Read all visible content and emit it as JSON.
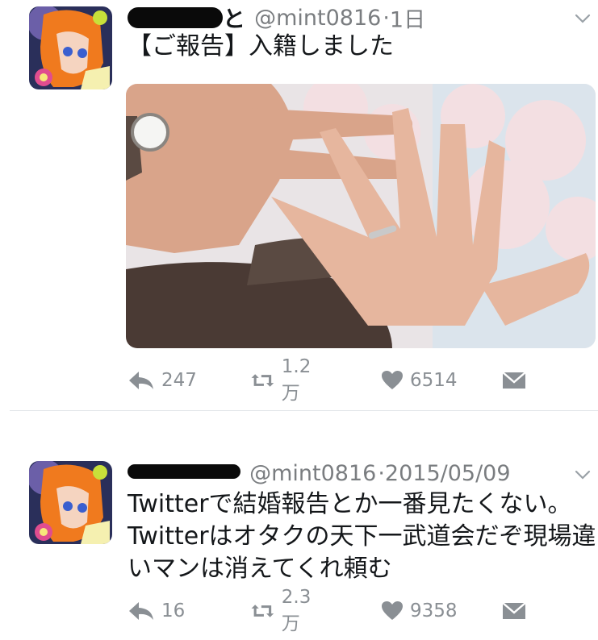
{
  "tweets": [
    {
      "name_visible_fragment": "と",
      "handle": "@mint0816",
      "sep": "·",
      "time": "1日",
      "text_lines": [
        "【ご報告】入籍しました"
      ],
      "actions": {
        "reply_count": "247",
        "retweet_count": "1.2万",
        "like_count": "6514"
      },
      "has_media": true
    },
    {
      "name_visible_fragment": "",
      "handle": "@mint0816",
      "sep": "·",
      "time": "2015/05/09",
      "text_lines": [
        "Twitterで結婚報告とか一番見たくない。",
        "Twitterはオタクの天下一武道会だぞ現場違",
        "いマンは消えてくれ頼む"
      ],
      "actions": {
        "reply_count": "16",
        "retweet_count": "2.3万",
        "like_count": "9358"
      },
      "has_media": false
    }
  ],
  "icons": {
    "reply": "reply-arrow-icon",
    "retweet": "retweet-icon",
    "like": "heart-icon",
    "dm": "envelope-icon",
    "menu": "chevron-down-icon"
  },
  "colors": {
    "icon_gray": "#8a8f94",
    "handle_gray": "#7a7d80",
    "text": "#14171a"
  }
}
